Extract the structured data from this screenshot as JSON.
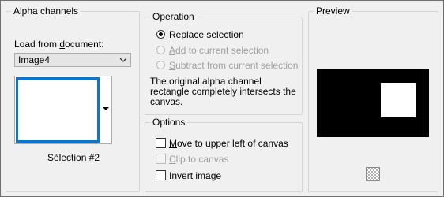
{
  "alpha_group": {
    "title": "Alpha channels",
    "load_label_prefix": "Load from ",
    "load_label_underlined": "d",
    "load_label_suffix": "ocument:",
    "document_value": "Image4",
    "channel_name": "Sélection #2"
  },
  "operation_group": {
    "title": "Operation",
    "options": [
      {
        "u": "R",
        "rest": "eplace selection",
        "selected": true,
        "enabled": true
      },
      {
        "u": "A",
        "rest": "dd to current selection",
        "selected": false,
        "enabled": false
      },
      {
        "u": "S",
        "rest": "ubtract from current selection",
        "selected": false,
        "enabled": false
      }
    ],
    "message_lines": [
      "The original alpha channel",
      "rectangle completely intersects the",
      "canvas."
    ]
  },
  "options_group": {
    "title": "Options",
    "items": [
      {
        "u": "M",
        "rest": "ove to upper left of canvas",
        "checked": false,
        "enabled": true
      },
      {
        "u": "C",
        "rest": "lip to canvas",
        "checked": false,
        "enabled": false
      },
      {
        "u": "I",
        "rest": "nvert image",
        "checked": false,
        "enabled": true
      }
    ]
  },
  "preview_group": {
    "title": "Preview",
    "canvas_color": "#000000",
    "selection_color": "#ffffff",
    "transparency_icon": "checkerboard-icon"
  }
}
